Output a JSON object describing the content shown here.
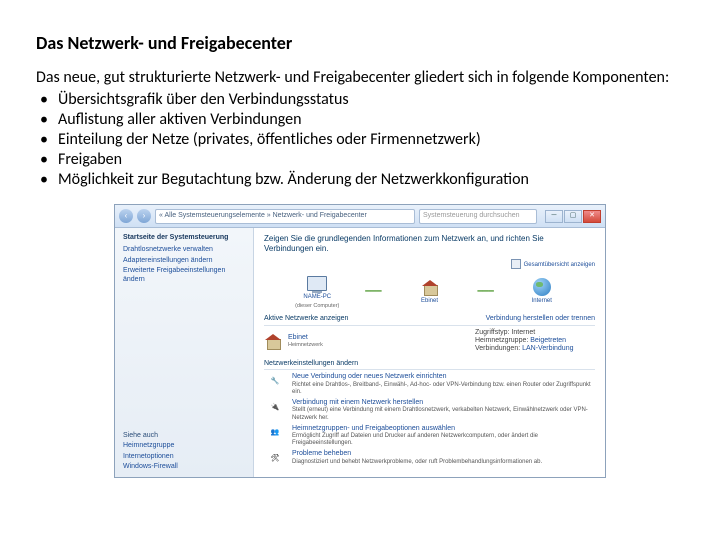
{
  "heading": "Das Netzwerk- und Freigabecenter",
  "intro": "Das neue, gut strukturierte Netzwerk- und Freigabecenter gliedert sich in folgende Komponenten:",
  "bullets": [
    "Übersichtsgrafik über den Verbindungsstatus",
    "Auflistung aller aktiven Verbindungen",
    "Einteilung der Netze (privates, öffentliches oder Firmennetzwerk)",
    "Freigaben",
    "Möglichkeit zur Begutachtung bzw. Änderung der Netzwerkkonfiguration"
  ],
  "window": {
    "addr": "« Alle Systemsteuerungselemente » Netzwerk- und Freigabecenter",
    "search": "Systemsteuerung durchsuchen",
    "side_header": "Startseite der Systemsteuerung",
    "side_links": [
      "Drahtlosnetzwerke verwalten",
      "Adaptereinstellungen ändern",
      "Erweiterte Freigabeeinstellungen ändern"
    ],
    "side_also_h": "Siehe auch",
    "side_also": [
      "Heimnetzgruppe",
      "Internetoptionen",
      "Windows-Firewall"
    ],
    "main_title": "Zeigen Sie die grundlegenden Informationen zum Netzwerk an, und richten Sie Verbindungen ein.",
    "map_link": "Gesamtübersicht anzeigen",
    "pc_name": "NAME-PC",
    "pc_sub": "(dieser Computer)",
    "net_name": "Ebinet",
    "inet_name": "Internet",
    "active_h": "Aktive Netzwerke anzeigen",
    "active_conn": "Verbindung herstellen oder trennen",
    "active_net": "Ebinet",
    "active_type": "Heimnetzwerk",
    "acc_lbl": "Zugriffstyp:",
    "acc_val": "Internet",
    "hg_lbl": "Heimnetzgruppe:",
    "hg_val": "Beigetreten",
    "con_lbl": "Verbindungen:",
    "con_val": "LAN-Verbindung",
    "cfg_h": "Netzwerkeinstellungen ändern",
    "cfg": [
      {
        "t": "Neue Verbindung oder neues Netzwerk einrichten",
        "d": "Richtet eine Drahtlos-, Breitband-, Einwähl-, Ad-hoc- oder VPN-Verbindung bzw. einen Router oder Zugriffspunkt ein."
      },
      {
        "t": "Verbindung mit einem Netzwerk herstellen",
        "d": "Stellt (erneut) eine Verbindung mit einem Drahtlosnetzwerk, verkabelten Netzwerk, Einwählnetzwerk oder VPN-Netzwerk her."
      },
      {
        "t": "Heimnetzgruppen- und Freigabeoptionen auswählen",
        "d": "Ermöglicht Zugriff auf Dateien und Drucker auf anderen Netzwerkcomputern, oder ändert die Freigabeeinstellungen."
      },
      {
        "t": "Probleme beheben",
        "d": "Diagnostiziert und behebt Netzwerkprobleme, oder ruft Problembehandlungsinformationen ab."
      }
    ]
  }
}
